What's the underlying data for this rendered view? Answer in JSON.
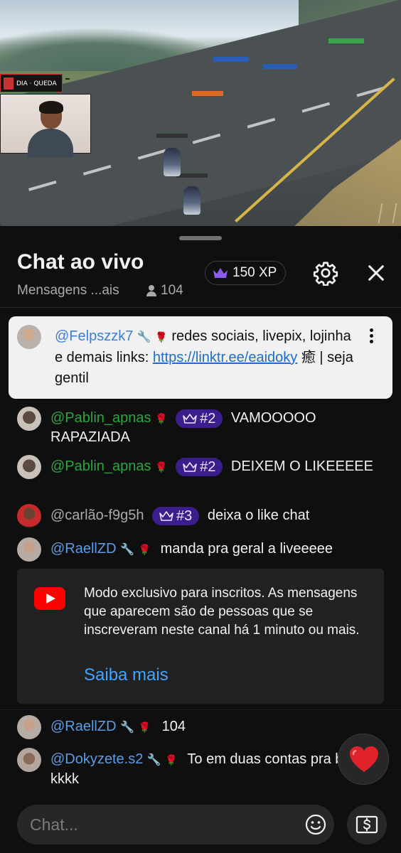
{
  "stream": {
    "hud_text": "DIA · QUEDA"
  },
  "chat": {
    "title": "Chat ao vivo",
    "mode": "Mensagens ...ais",
    "viewer_count": "104",
    "xp": "150 XP",
    "pinned": {
      "author": "@Felpszzk7",
      "text_before_link": " redes sociais, livepix, lojinha e demais links: ",
      "link_text": "https://linktr.ee/eaidoky",
      "text_after_link": " 癒 | seja gentil"
    },
    "messages": [
      {
        "author": "@Pablin_apnas",
        "badge": "#2",
        "text": "VAMOOOOO RAPAZIADA"
      },
      {
        "author": "@Pablin_apnas",
        "badge": "#2",
        "text": "DEIXEM O LIKEEEEE"
      },
      {
        "author": "@carlão-f9g5h",
        "badge": "#3",
        "text": "deixa o like chat"
      },
      {
        "author": "@RaellZD",
        "text": "manda pra geral a liveeeee"
      }
    ],
    "notice": {
      "text": "Modo exclusivo para inscritos. As mensagens que aparecem são de pessoas que se inscreveram neste canal há 1 minuto ou mais.",
      "link": "Saiba mais"
    },
    "messages_after": [
      {
        "author": "@RaellZD",
        "text": "104"
      },
      {
        "author": "@Dokyzete.s2",
        "text": "To em duas contas pra bater kkkk"
      }
    ],
    "input_placeholder": "Chat..."
  },
  "colors": {
    "background": "#0f0f0f",
    "member_name": "#2ba640",
    "moderator_name": "#5b9de5",
    "badge_bg": "#3b1e8c",
    "link": "#3ea6ff",
    "youtube_red": "#ff0000"
  },
  "icons": {
    "xp": "crown-icon",
    "settings": "gear-icon",
    "close": "close-icon",
    "moderator": "wrench-icon",
    "member": "rose-icon",
    "menu": "kebab-icon",
    "emoji": "emoji-icon",
    "super_chat": "money-icon",
    "reaction": "heart-icon"
  }
}
